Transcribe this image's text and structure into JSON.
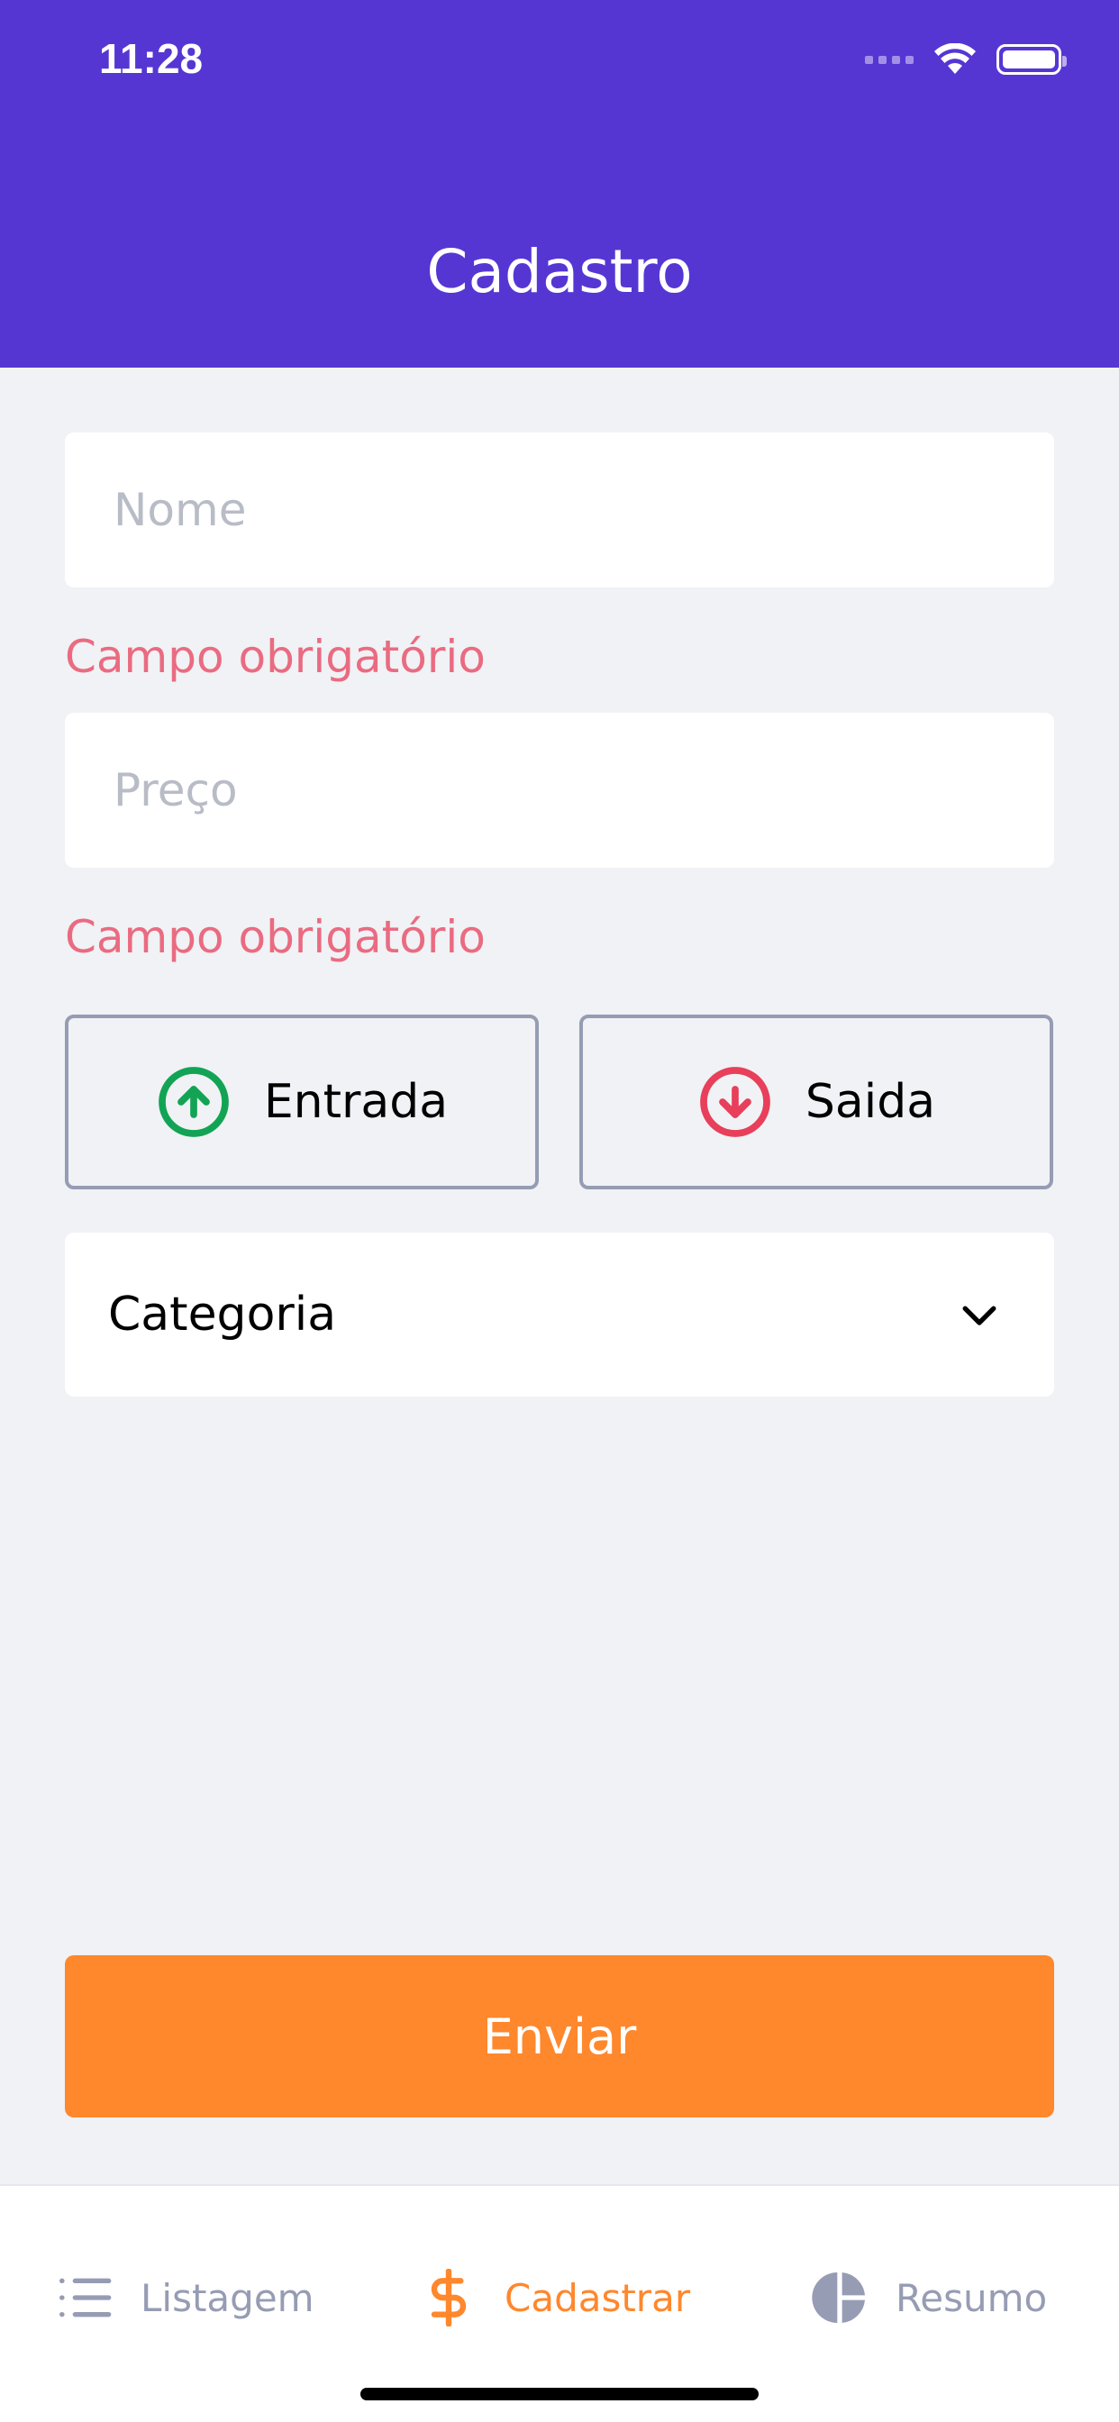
{
  "status_bar": {
    "time": "11:28"
  },
  "header": {
    "title": "Cadastro"
  },
  "form": {
    "name": {
      "placeholder": "Nome",
      "value": "",
      "error": "Campo obrigatório"
    },
    "price": {
      "placeholder": "Preço",
      "value": "",
      "error": "Campo obrigatório"
    },
    "types": {
      "income_label": "Entrada",
      "outcome_label": "Saida"
    },
    "category": {
      "label": "Categoria"
    },
    "submit_label": "Enviar"
  },
  "tabbar": {
    "items": [
      {
        "label": "Listagem",
        "icon": "list-icon"
      },
      {
        "label": "Cadastrar",
        "icon": "dollar-sign-icon"
      },
      {
        "label": "Resumo",
        "icon": "pie-chart-icon"
      }
    ],
    "active_index": 1
  },
  "colors": {
    "primary": "#5636d3",
    "secondary": "#ff872c",
    "success": "#12a454",
    "attention": "#e83f5b",
    "text_muted": "#969cb3",
    "background": "#f0f2f5"
  }
}
